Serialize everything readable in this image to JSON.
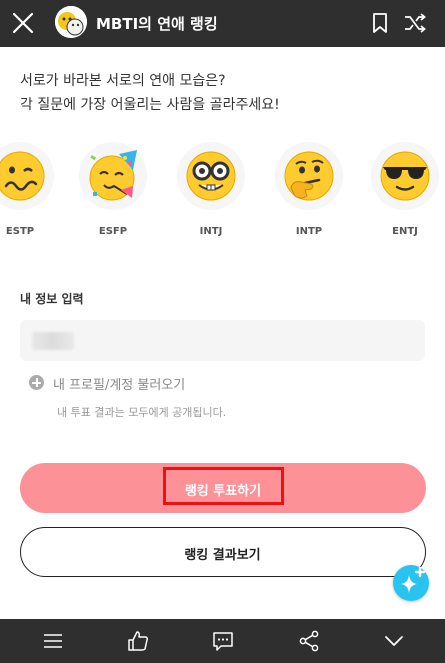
{
  "topbar": {
    "title": "MBTI의 연애 랭킹",
    "icons": [
      "close-icon",
      "avatar",
      "bookmark-icon",
      "shuffle-icon"
    ]
  },
  "intro": {
    "line1": "서로가 바라본 서로의 연애 모습은?",
    "line2": "각 질문에 가장 어울리는 사람을 골라주세요!"
  },
  "mbti_types": [
    {
      "label": "ESTP",
      "icon": "woozy-face-icon"
    },
    {
      "label": "ESFP",
      "icon": "partying-face-icon"
    },
    {
      "label": "INTJ",
      "icon": "nerd-face-icon"
    },
    {
      "label": "INTP",
      "icon": "thinking-face-icon"
    },
    {
      "label": "ENTJ",
      "icon": "sunglasses-face-icon"
    }
  ],
  "form": {
    "section_label": "내 정보 입력",
    "load_profile": "내 프로필/계정 불러오기",
    "public_note": "내 투표 결과는 모두에게 공개됩니다."
  },
  "buttons": {
    "vote": "랭킹 투표하기",
    "results": "랭킹 결과보기"
  },
  "bottombar": {
    "icons": [
      "menu-icon",
      "thumbs-up-icon",
      "comment-icon",
      "share-icon",
      "chevron-down-icon"
    ]
  },
  "colors": {
    "bar": "#2f2f2f",
    "vote_button": "#fc9198",
    "highlight": "#ea1313",
    "fab": "#29c3ef"
  }
}
